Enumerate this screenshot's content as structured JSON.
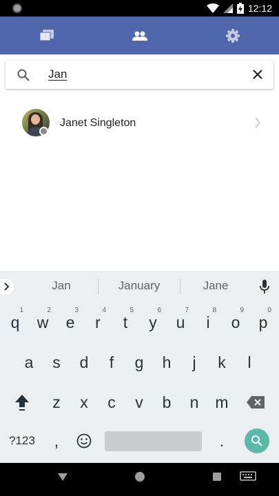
{
  "status_bar": {
    "time": "12:12"
  },
  "search": {
    "query": "Jan"
  },
  "contacts": [
    {
      "name": "Janet Singleton"
    }
  ],
  "keyboard": {
    "suggestions": [
      "Jan",
      "January",
      "Jane"
    ],
    "row1": [
      {
        "k": "q",
        "h": "1"
      },
      {
        "k": "w",
        "h": "2"
      },
      {
        "k": "e",
        "h": "3"
      },
      {
        "k": "r",
        "h": "4"
      },
      {
        "k": "t",
        "h": "5"
      },
      {
        "k": "y",
        "h": "6"
      },
      {
        "k": "u",
        "h": "7"
      },
      {
        "k": "i",
        "h": "8"
      },
      {
        "k": "o",
        "h": "9"
      },
      {
        "k": "p",
        "h": "0"
      }
    ],
    "row2": [
      "a",
      "s",
      "d",
      "f",
      "g",
      "h",
      "j",
      "k",
      "l"
    ],
    "row3": [
      "z",
      "x",
      "c",
      "v",
      "b",
      "n",
      "m"
    ],
    "symbols_key": "?123",
    "comma_key": ",",
    "period_key": "."
  }
}
